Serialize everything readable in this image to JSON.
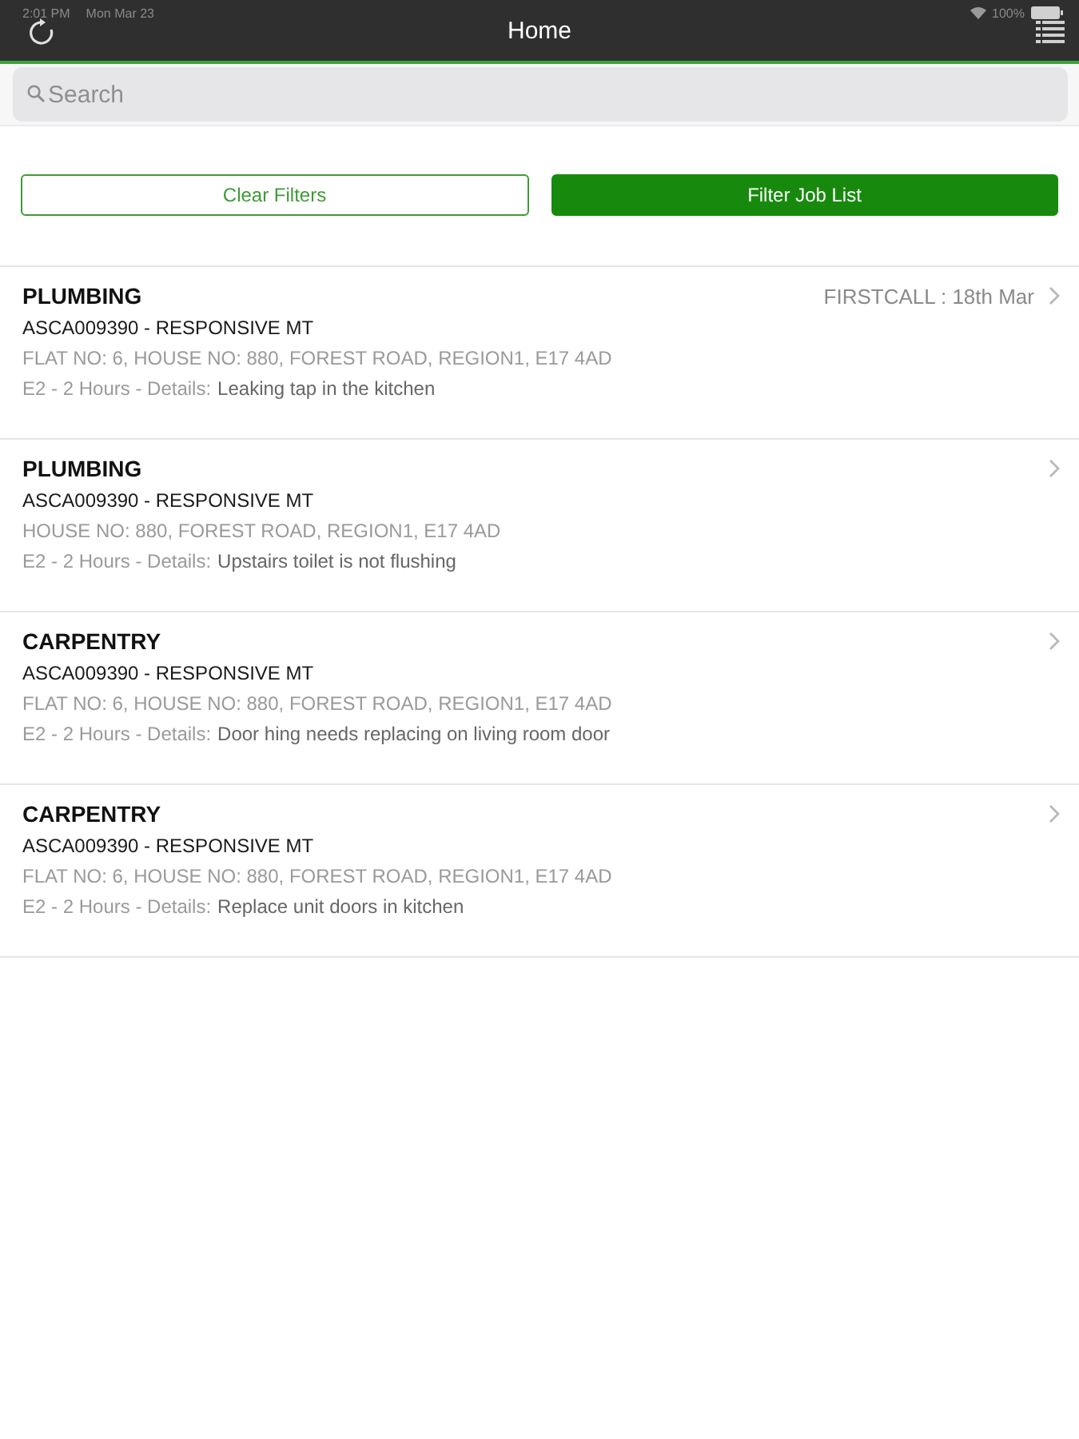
{
  "status_bar": {
    "time": "2:01 PM",
    "date": "Mon Mar 23",
    "battery": "100%"
  },
  "nav_bar": {
    "title": "Home"
  },
  "search": {
    "placeholder": "Search"
  },
  "buttons": [
    {
      "label": "Clear Filters",
      "kind": "outline"
    },
    {
      "label": "Filter Job List",
      "kind": "filled"
    }
  ],
  "jobs": [
    {
      "trade": "PLUMBING",
      "appointment": "FIRSTCALL : 18th Mar",
      "reference": "ASCA009390 - RESPONSIVE MT",
      "address": "FLAT NO: 6, HOUSE NO: 880, FOREST ROAD, REGION1, E17 4AD",
      "priority": "E2 - 2 Hours - Details:",
      "description": "Leaking tap in the kitchen"
    },
    {
      "trade": "PLUMBING",
      "reference": "ASCA009390 - RESPONSIVE MT",
      "address": "HOUSE NO: 880, FOREST ROAD, REGION1, E17 4AD",
      "priority": "E2 - 2 Hours - Details:",
      "description": "Upstairs toilet is not flushing"
    },
    {
      "trade": "CARPENTRY",
      "reference": "ASCA009390 - RESPONSIVE MT",
      "address": "FLAT NO: 6, HOUSE NO: 880, FOREST ROAD, REGION1, E17 4AD",
      "priority": "E2 - 2 Hours - Details:",
      "description": "Door hing needs replacing on living room door"
    },
    {
      "trade": "CARPENTRY",
      "reference": "ASCA009390 - RESPONSIVE MT",
      "address": "FLAT NO: 6, HOUSE NO: 880, FOREST ROAD, REGION1, E17 4AD",
      "priority": "E2 - 2 Hours - Details:",
      "description": "Replace unit doors in kitchen"
    }
  ]
}
